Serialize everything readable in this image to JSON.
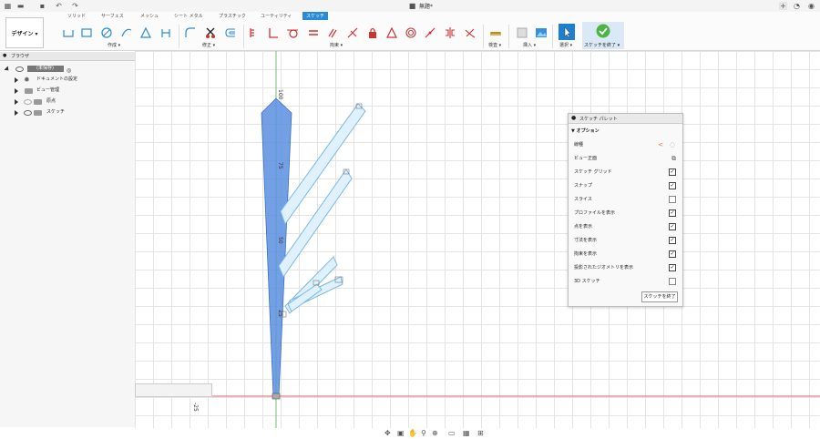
{
  "title_bar": {
    "doc_title": "無題*",
    "icons": [
      "grid-icon",
      "file-icon",
      "save-icon",
      "undo-icon",
      "redo-icon",
      "cube-icon",
      "plus-icon",
      "clock-icon",
      "globe-icon",
      "user-icon"
    ]
  },
  "ribbon": {
    "workspace_button": "デザイン ▾",
    "tabs": [
      "ソリッド",
      "サーフェス",
      "メッシュ",
      "シート メタル",
      "プラスチック",
      "ユーティリティ",
      "スケッチ"
    ],
    "active_tab": "スケッチ",
    "groups": {
      "create": "作成 ▾",
      "modify": "修正 ▾",
      "constraints": "拘束 ▾",
      "inspect": "検査 ▾",
      "insert": "挿入 ▾",
      "select": "選択 ▾",
      "finish": "スケッチを終了 ▾"
    },
    "accent_color": "#2a8ad8",
    "finish_color": "#4bb543"
  },
  "browser": {
    "title": "ブラウザ",
    "root": "(未保存)",
    "items": [
      {
        "label": "ドキュメントの設定",
        "icon": "gear-icon"
      },
      {
        "label": "ビュー管理",
        "icon": "folder-icon"
      },
      {
        "label": "原点",
        "icon": "folder-icon"
      },
      {
        "label": "スケッチ",
        "icon": "folder-icon"
      }
    ]
  },
  "viewport": {
    "dimension_100": "100",
    "dimension_75": "75",
    "dimension_50": "50",
    "dimension_25": "25",
    "dimension_neg25": "-25",
    "axis_x_color": "#e06060",
    "axis_y_color": "#70c070",
    "profile_fill": "#5b8fe0",
    "sketch_color": "#7ab8e6"
  },
  "palette": {
    "title": "スケッチ パレット",
    "section": "▼ オプション",
    "rows": [
      {
        "label": "線種",
        "kind": "linetype"
      },
      {
        "label": "ビュー正面",
        "kind": "icon"
      },
      {
        "label": "スケッチ グリッド",
        "kind": "check",
        "checked": true
      },
      {
        "label": "スナップ",
        "kind": "check",
        "checked": true
      },
      {
        "label": "スライス",
        "kind": "check",
        "checked": false
      },
      {
        "label": "プロファイルを表示",
        "kind": "check",
        "checked": true
      },
      {
        "label": "点を表示",
        "kind": "check",
        "checked": true
      },
      {
        "label": "寸法を表示",
        "kind": "check",
        "checked": true
      },
      {
        "label": "拘束を表示",
        "kind": "check",
        "checked": true
      },
      {
        "label": "投影されたジオメトリを表示",
        "kind": "check",
        "checked": true
      },
      {
        "label": "3D スケッチ",
        "kind": "check",
        "checked": false
      }
    ],
    "finish_button": "スケッチを終了",
    "check_mark": "✓"
  }
}
